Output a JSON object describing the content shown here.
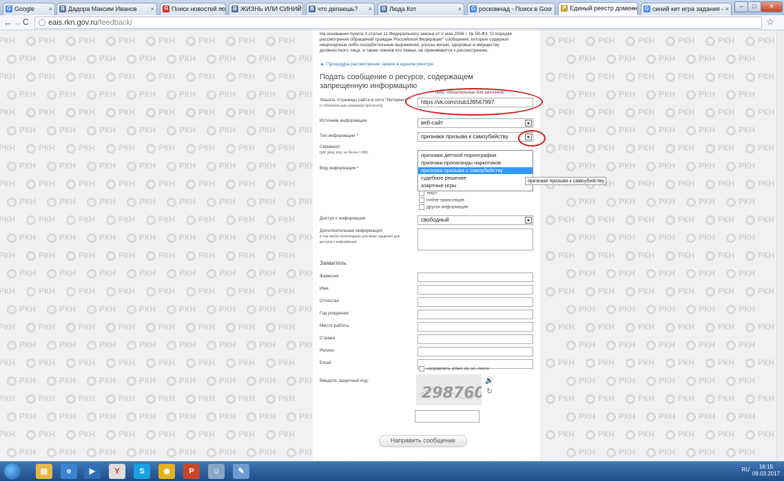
{
  "browser": {
    "tabs": [
      {
        "label": "Google",
        "favicon": "G",
        "color": "#4285f4"
      },
      {
        "label": "Дадора Максим Иванов",
        "favicon": "В",
        "color": "#507299"
      },
      {
        "label": "Поиск новостей по запро",
        "favicon": "Я",
        "color": "#d22"
      },
      {
        "label": "ЖИЗНЬ ИЛИ СИНИЙ КИТ",
        "favicon": "В",
        "color": "#507299"
      },
      {
        "label": "что делаешь?",
        "favicon": "В",
        "color": "#507299"
      },
      {
        "label": "Люда Кот",
        "favicon": "В",
        "color": "#507299"
      },
      {
        "label": "роскомнад - Поиск в Goo",
        "favicon": "G",
        "color": "#4285f4"
      },
      {
        "label": "Единый реестр доменны",
        "favicon": "Р",
        "color": "#c8a12a"
      },
      {
        "label": "синий кит игра задания -",
        "favicon": "G",
        "color": "#4285f4"
      }
    ],
    "url_host": "eais.rkn.gov.ru",
    "url_path": "/feedback/"
  },
  "watermark": "РКН",
  "form": {
    "intro": "На основании пункта 3 статьи 11 Федерального закона от 2 мая 2006 г. № 59-ФЗ \"О порядке рассмотрения обращений граждан Российской Федерации\" сообщения, которые содержат нецензурные либо оскорбительные выражения, угрозы жизни, здоровью и имуществу должностного лица, а также членов его семьи, не принимаются к рассмотрению.",
    "procedure_link": "Процедура рассмотрения заявок в едином реестре",
    "heading": "Подать сообщение о ресурсе, содержащем запрещенную информацию",
    "required_note": "* - поля, обязательные для заполнени",
    "url_label": "Указать страницы сайта в сети \"Интернет\" *",
    "url_hint": "(с обязательным указанием протокола)",
    "url_value": "https://vk.com/club139567997",
    "source_label": "Источник информации",
    "source_value": "веб-сайт",
    "type_label": "Тип информации *",
    "type_value": "признаки призыва к самоубийству",
    "type_options": [
      "признаки детской порнографии",
      "признаки пропаганды наркотиков",
      "признаки призыва к самоубийству",
      "судебное решение",
      "азартные игры"
    ],
    "tooltip": "признаки призыва к самоубийству",
    "screenshot_label": "Скриншот",
    "screenshot_hint": "(pdf, jpeg, png, не более 1 Мб)",
    "kind_label": "Вид информации *",
    "kind_checkboxes": [
      "текст",
      "online-трансляция",
      "другая информация"
    ],
    "access_label": "Доступ к информации",
    "access_value": "свободный",
    "extra_label": "Дополнительная информация",
    "extra_hint": "в том числе логин/пароль или иные сведения для доступа к информации",
    "applicant_heading": "Заявитель",
    "applicant_fields": [
      "Фамилия",
      "Имя",
      "Отчество",
      "Год рождения",
      "Место работы",
      "Страна",
      "Регион",
      "Email"
    ],
    "email_reply": "направлять ответ по эл. почте",
    "captcha_label": "Введите защитный код:",
    "captcha_text": "298760",
    "submit": "Направить сообщение"
  },
  "taskbar": {
    "lang": "RU",
    "time": "16:15",
    "date": "09.03.2017"
  }
}
